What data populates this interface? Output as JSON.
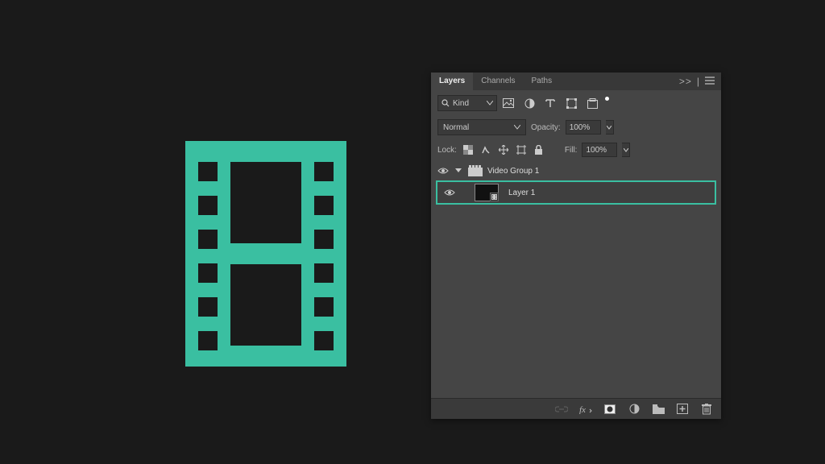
{
  "accent": "#3abfa1",
  "tabs": {
    "layers": "Layers",
    "channels": "Channels",
    "paths": "Paths"
  },
  "filter": {
    "label": "Kind"
  },
  "blend": {
    "mode": "Normal",
    "opacity_label": "Opacity:",
    "opacity_value": "100%"
  },
  "lock": {
    "label": "Lock:",
    "fill_label": "Fill:",
    "fill_value": "100%"
  },
  "layers": {
    "group": {
      "name": "Video Group 1"
    },
    "layer": {
      "name": "Layer 1"
    }
  }
}
